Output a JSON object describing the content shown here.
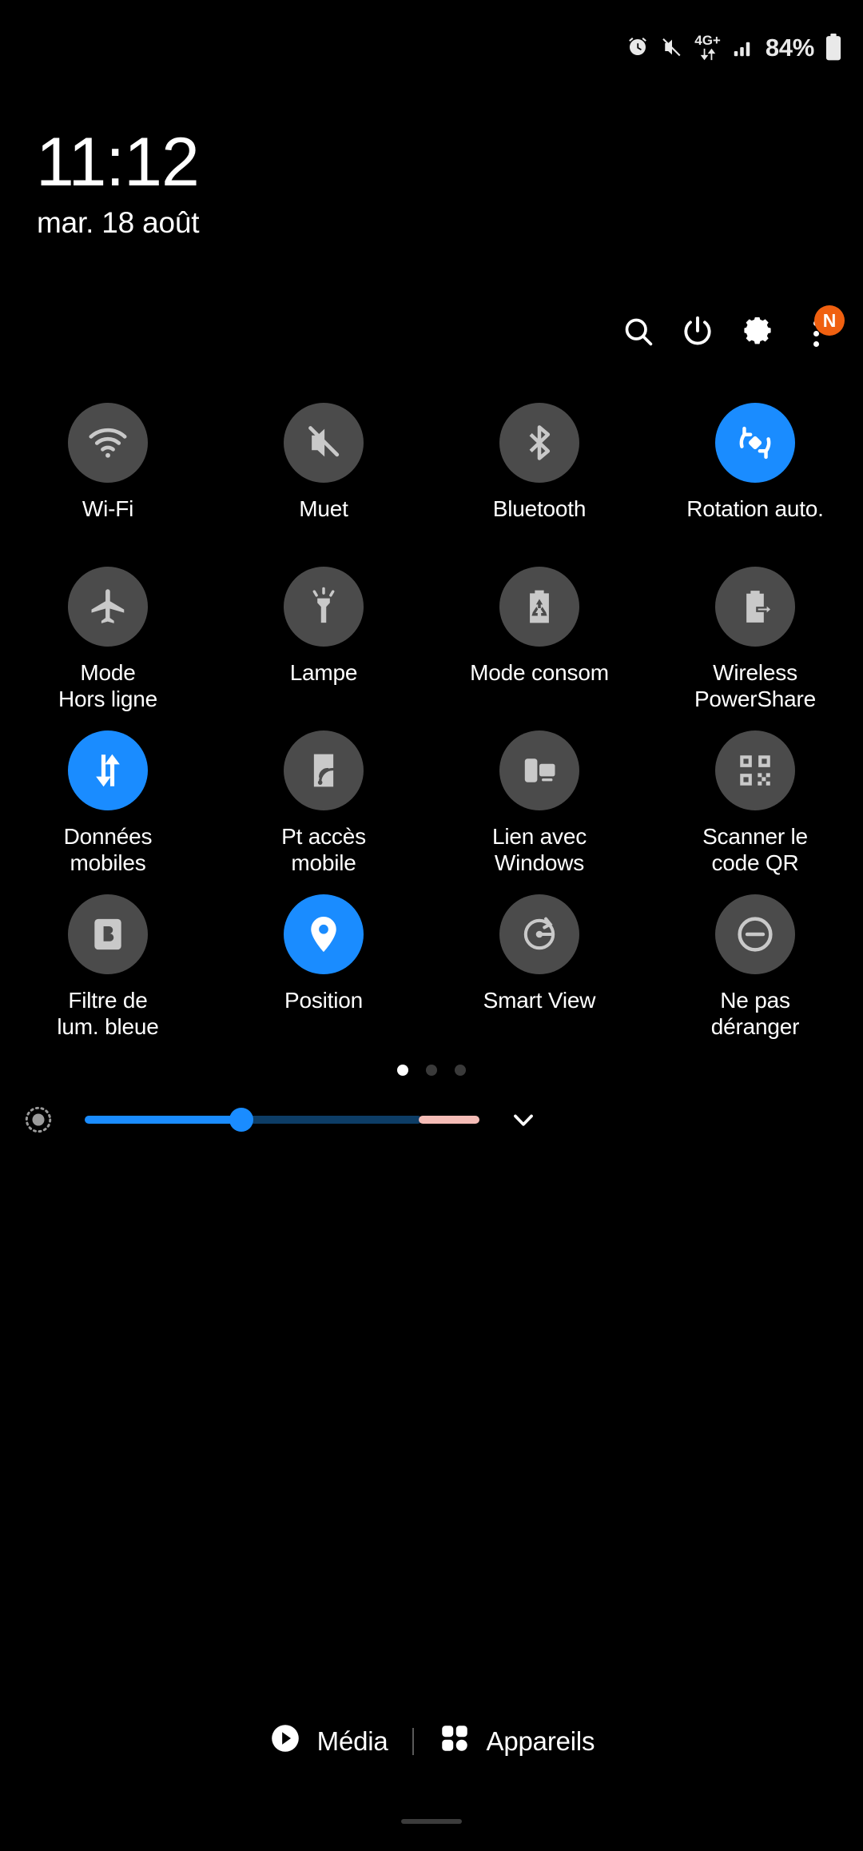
{
  "status_bar": {
    "battery_percent": "84%",
    "network_type": "4G+",
    "icons": [
      "alarm-icon",
      "mute-icon",
      "mobile-data-icon",
      "signal-icon",
      "battery-icon"
    ]
  },
  "header": {
    "time": "11:12",
    "date": "mar. 18 août",
    "actions": [
      {
        "name": "search-icon",
        "label": "Rechercher"
      },
      {
        "name": "power-icon",
        "label": "Marche/Arrêt"
      },
      {
        "name": "gear-icon",
        "label": "Paramètres"
      },
      {
        "name": "more-options-icon",
        "label": "Plus d'options",
        "badge": "N"
      }
    ]
  },
  "tiles": [
    {
      "label": "Wi-Fi",
      "icon": "wifi-icon",
      "active": false,
      "clip": false
    },
    {
      "label": "Muet",
      "icon": "mute-icon",
      "active": false,
      "clip": false
    },
    {
      "label": "Bluetooth",
      "icon": "bluetooth-icon",
      "active": false,
      "clip": false
    },
    {
      "label": "Rotation auto.",
      "icon": "auto-rotate-icon",
      "active": true,
      "clip": false
    },
    {
      "label": "Mode\nHors ligne",
      "icon": "airplane-icon",
      "active": false,
      "clip": false
    },
    {
      "label": "Lampe",
      "icon": "flashlight-icon",
      "active": false,
      "clip": false
    },
    {
      "label": "Mode consom",
      "icon": "power-saving-icon",
      "active": false,
      "clip": true
    },
    {
      "label": "Wireless\nPowerShare",
      "icon": "power-share-icon",
      "active": false,
      "clip": false
    },
    {
      "label": "Données\nmobiles",
      "icon": "mobile-data-icon",
      "active": true,
      "clip": false
    },
    {
      "label": "Pt accès\nmobile",
      "icon": "hotspot-icon",
      "active": false,
      "clip": false
    },
    {
      "label": "Lien avec\nWindows",
      "icon": "link-to-windows-icon",
      "active": false,
      "clip": false
    },
    {
      "label": "Scanner le\ncode QR",
      "icon": "qr-code-icon",
      "active": false,
      "clip": false
    },
    {
      "label": "Filtre de\nlum. bleue",
      "icon": "blue-light-icon",
      "active": false,
      "clip": false
    },
    {
      "label": "Position",
      "icon": "location-icon",
      "active": true,
      "clip": false
    },
    {
      "label": "Smart View",
      "icon": "smart-view-icon",
      "active": false,
      "clip": false
    },
    {
      "label": "Ne pas\ndéranger",
      "icon": "do-not-disturb-icon",
      "active": false,
      "clip": false
    }
  ],
  "pagination": {
    "pages": 3,
    "current": 1
  },
  "brightness": {
    "icon": "brightness-icon",
    "value_percent": 41,
    "expand_icon": "chevron-down-icon"
  },
  "bottom_bar": {
    "media_label": "Média",
    "devices_label": "Appareils",
    "media_icon": "play-circle-icon",
    "devices_icon": "devices-grid-icon"
  },
  "colors": {
    "accent": "#1a8cff",
    "tile_off": "#4b4b4b",
    "badge": "#f06010",
    "warm_track": "#f5bcb6",
    "background": "#000000"
  }
}
